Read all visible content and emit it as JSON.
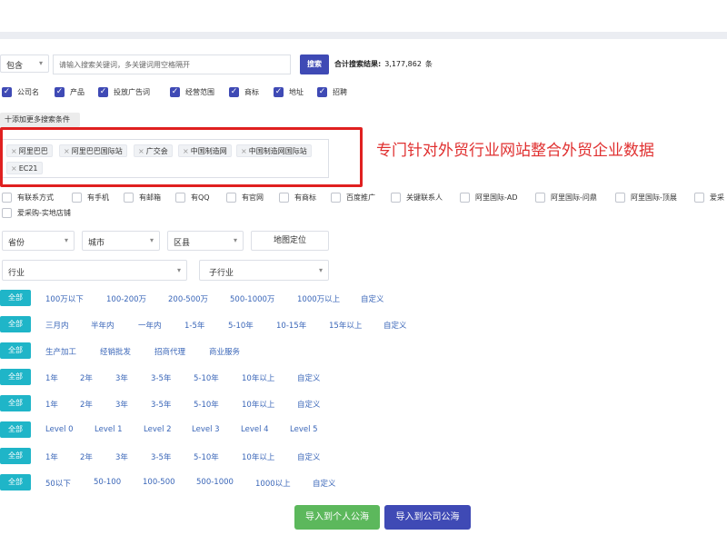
{
  "search": {
    "match_mode": "包含",
    "placeholder": "请输入搜索关键词，多关键词用空格隔开",
    "button_label": "搜索",
    "result_label": "合计搜索结果:",
    "result_count": "3,177,862",
    "result_unit": "条"
  },
  "search_fields": [
    "公司名",
    "产品",
    "投放广告词",
    "经营范围",
    "商标",
    "地址",
    "招聘"
  ],
  "add_more_label": "十添加更多搜索条件",
  "tags": [
    "阿里巴巴",
    "阿里巴巴国际站",
    "广交会",
    "中国制造网",
    "中国制造网国际站",
    "EC21"
  ],
  "tag_remove_glyph": "×",
  "annotation": "专门针对外贸行业网站整合外贸企业数据",
  "attribute_filters": [
    "有联系方式",
    "有手机",
    "有邮箱",
    "有QQ",
    "有官网",
    "有商标",
    "百度推广",
    "关键联系人",
    "阿里国际-AD",
    "阿里国际-问鼎",
    "阿里国际-顶展",
    "爱采",
    "爱采购-实地店铺"
  ],
  "region": {
    "province": "省份",
    "city": "城市",
    "district": "区县",
    "map_button": "地图定位"
  },
  "industry": {
    "industry": "行业",
    "sub_industry": "子行业"
  },
  "filter_rows": [
    {
      "all": "全部",
      "options": [
        "100万以下",
        "100-200万",
        "200-500万",
        "500-1000万",
        "1000万以上",
        "自定义"
      ]
    },
    {
      "all": "全部",
      "options": [
        "三月内",
        "半年内",
        "一年内",
        "1-5年",
        "5-10年",
        "10-15年",
        "15年以上",
        "自定义"
      ]
    },
    {
      "all": "全部",
      "options": [
        "生产加工",
        "经销批发",
        "招商代理",
        "商业服务"
      ]
    },
    {
      "all": "全部",
      "options": [
        "1年",
        "2年",
        "3年",
        "3-5年",
        "5-10年",
        "10年以上",
        "自定义"
      ]
    },
    {
      "all": "全部",
      "options": [
        "1年",
        "2年",
        "3年",
        "3-5年",
        "5-10年",
        "10年以上",
        "自定义"
      ]
    },
    {
      "all": "全部",
      "options": [
        "Level 0",
        "Level 1",
        "Level 2",
        "Level 3",
        "Level 4",
        "Level 5"
      ]
    },
    {
      "all": "全部",
      "options": [
        "1年",
        "2年",
        "3年",
        "3-5年",
        "5-10年",
        "10年以上",
        "自定义"
      ]
    },
    {
      "all": "全部",
      "options": [
        "50以下",
        "50-100",
        "100-500",
        "500-1000",
        "1000以上",
        "自定义"
      ]
    }
  ],
  "actions": {
    "import_personal": "导入到个人公海",
    "import_company": "导入到公司公海"
  },
  "colors": {
    "primary": "#3f4ab5",
    "teal": "#1fb5c8",
    "green": "#5cb85c",
    "link": "#3a66b8",
    "annotation_red": "#e02020"
  },
  "icons": {
    "checkbox_checked": "check-icon",
    "dropdown": "chevron-down-icon"
  }
}
